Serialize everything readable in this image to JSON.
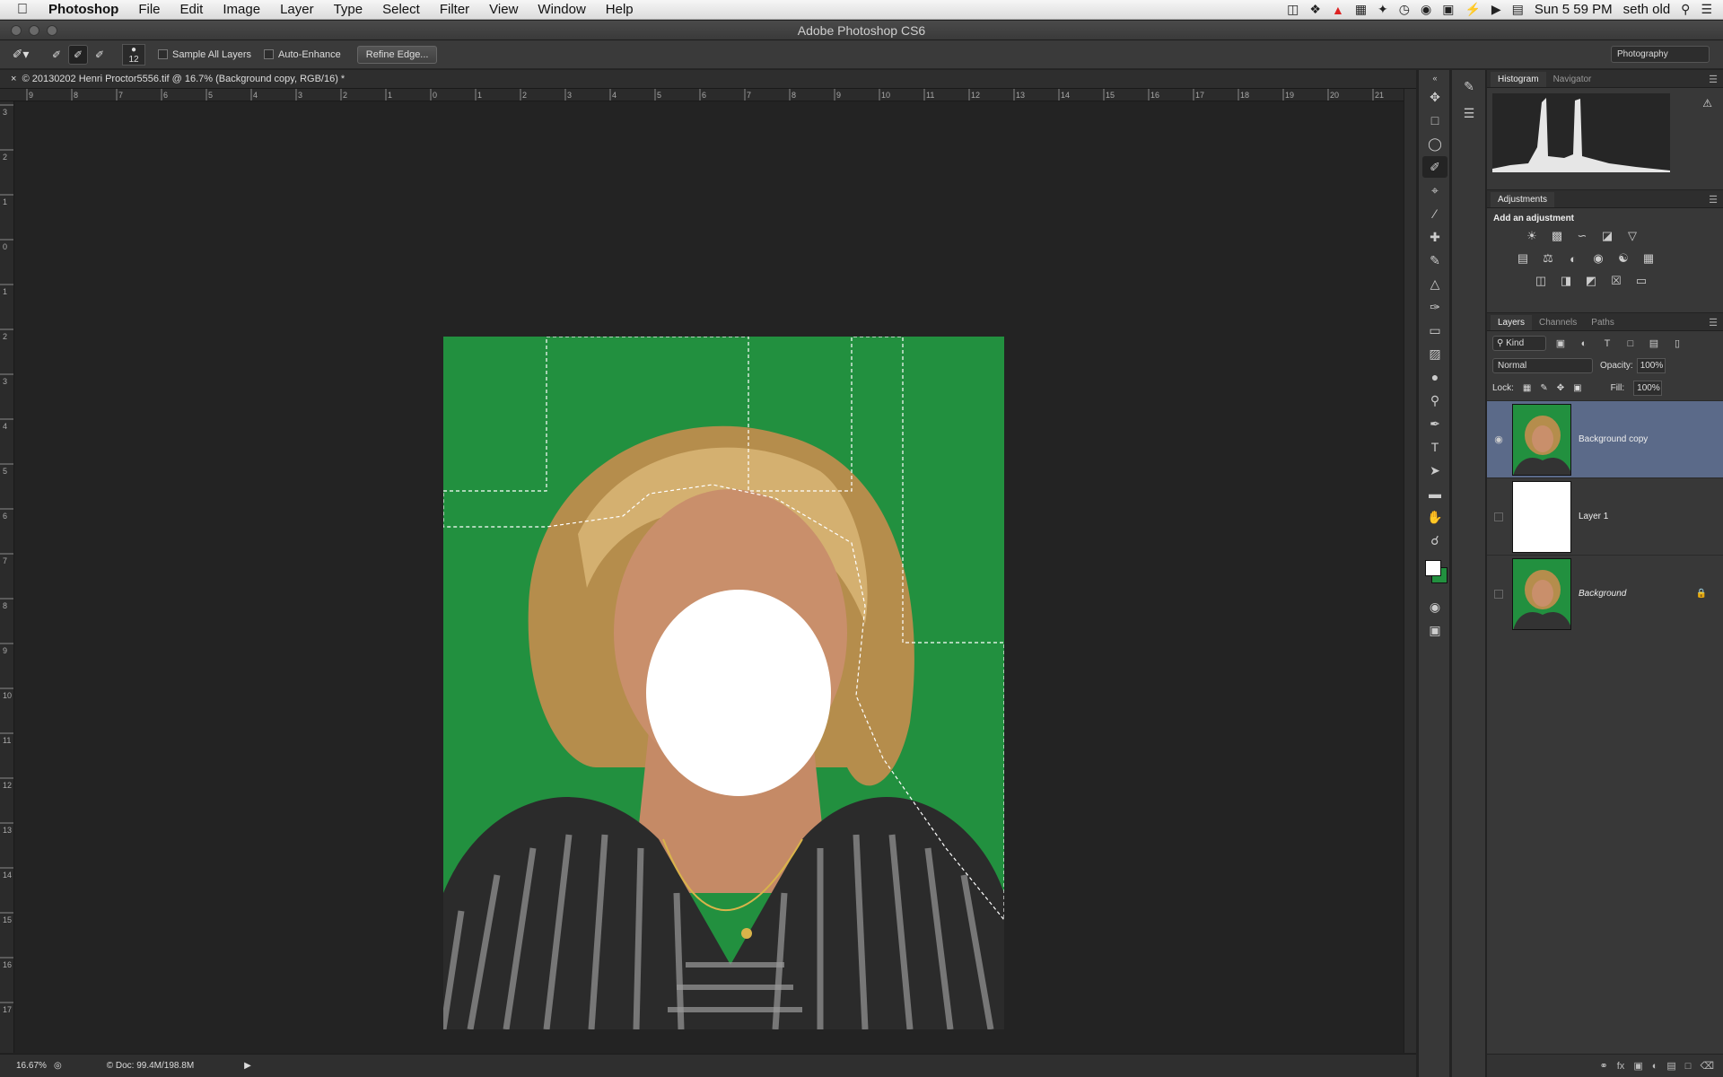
{
  "menubar": {
    "app_name": "Photoshop",
    "items": [
      "File",
      "Edit",
      "Image",
      "Layer",
      "Type",
      "Select",
      "Filter",
      "View",
      "Window",
      "Help"
    ],
    "clock": "Sun 5 59 PM",
    "user": "seth old"
  },
  "window": {
    "title": "Adobe Photoshop CS6"
  },
  "options_bar": {
    "brush_size": "12",
    "sample_all_layers": "Sample All Layers",
    "auto_enhance": "Auto-Enhance",
    "refine_edge": "Refine Edge...",
    "workspace": "Photography"
  },
  "document": {
    "tab_title": "© 20130202 Henri Proctor5556.tif @ 16.7% (Background copy, RGB/16) *",
    "ruler_h_labels": [
      "9",
      "8",
      "7",
      "6",
      "5",
      "4",
      "3",
      "2",
      "1",
      "0",
      "1",
      "2",
      "3",
      "4",
      "5",
      "6",
      "7",
      "8",
      "9",
      "10",
      "11",
      "12",
      "13",
      "14",
      "15",
      "16",
      "17",
      "18",
      "19",
      "20",
      "21"
    ],
    "ruler_v_labels": [
      "3",
      "2",
      "1",
      "0",
      "1",
      "2",
      "3",
      "4",
      "5",
      "6",
      "7",
      "8",
      "9",
      "10",
      "11",
      "12",
      "13",
      "14",
      "15",
      "16",
      "17"
    ]
  },
  "status_bar": {
    "zoom": "16.67%",
    "doc_size": "© Doc: 99.4M/198.8M"
  },
  "histogram_panel": {
    "tabs": [
      "Histogram",
      "Navigator"
    ]
  },
  "adjustments_panel": {
    "title": "Adjustments",
    "subtitle": "Add an adjustment"
  },
  "layers_panel": {
    "tabs": [
      "Layers",
      "Channels",
      "Paths"
    ],
    "kind": "Kind",
    "blend_mode": "Normal",
    "opacity_label": "Opacity:",
    "opacity": "100%",
    "lock_label": "Lock:",
    "fill_label": "Fill:",
    "fill": "100%",
    "layers": [
      {
        "name": "Background copy"
      },
      {
        "name": "Layer 1"
      },
      {
        "name": "Background"
      }
    ]
  },
  "colors": {
    "foreground": "#ffffff",
    "background": "#22903f",
    "selected_layer": "#5b6a89"
  }
}
